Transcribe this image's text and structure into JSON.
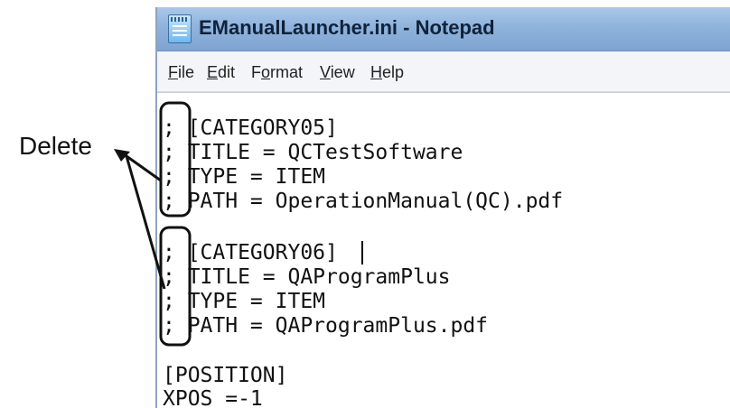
{
  "window": {
    "title": "EManualLauncher.ini - Notepad",
    "app_icon": "notepad-icon"
  },
  "menu": [
    {
      "label": "File"
    },
    {
      "label": "Edit"
    },
    {
      "label": "Format"
    },
    {
      "label": "View"
    },
    {
      "label": "Help"
    }
  ],
  "editor": {
    "lines": [
      "; [CATEGORY05]",
      "; TITLE = QCTestSoftware",
      "; TYPE = ITEM",
      "; PATH = OperationManual(QC).pdf",
      "",
      "; [CATEGORY06]",
      "; TITLE = QAProgramPlus",
      "; TYPE = ITEM",
      "; PATH = QAProgramPlus.pdf",
      "",
      "[POSITION]",
      "XPOS =-1"
    ]
  },
  "annotation": {
    "label": "Delete",
    "color": "#111111"
  }
}
